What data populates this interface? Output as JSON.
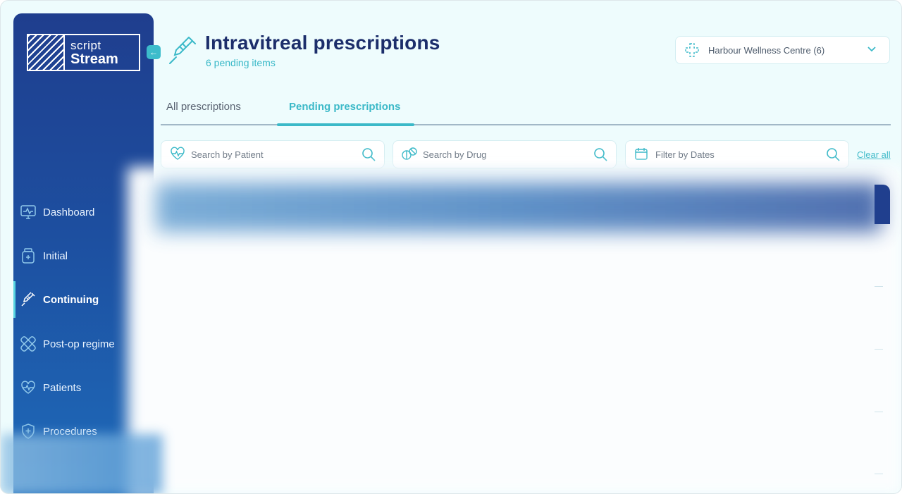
{
  "brand": {
    "line1": "script",
    "line2": "Stream"
  },
  "collapse_icon": "arrow-left-icon",
  "sidebar": {
    "items": [
      {
        "label": "Dashboard",
        "icon": "monitor-pulse-icon",
        "active": false
      },
      {
        "label": "Initial",
        "icon": "medicine-bottle-icon",
        "active": false
      },
      {
        "label": "Continuing",
        "icon": "syringe-icon",
        "active": true
      },
      {
        "label": "Post-op regime",
        "icon": "bandage-icon",
        "active": false
      },
      {
        "label": "Patients",
        "icon": "heart-pulse-icon",
        "active": false
      },
      {
        "label": "Procedures",
        "icon": "shield-plus-icon",
        "active": false
      }
    ]
  },
  "header": {
    "title": "Intravitreal prescriptions",
    "subtitle": "6 pending items",
    "clinic": "Harbour Wellness Centre (6)"
  },
  "tabs": [
    {
      "label": "All prescriptions",
      "active": false
    },
    {
      "label": "Pending prescriptions",
      "active": true
    }
  ],
  "filters": {
    "patient_placeholder": "Search by Patient",
    "drug_placeholder": "Search by Drug",
    "dates_placeholder": "Filter by Dates",
    "clear_label": "Clear all"
  },
  "colors": {
    "accent": "#3bb9c8",
    "navy": "#1c2e6b",
    "sidebar_top": "#1f3e8e",
    "background": "#eefcfd"
  }
}
